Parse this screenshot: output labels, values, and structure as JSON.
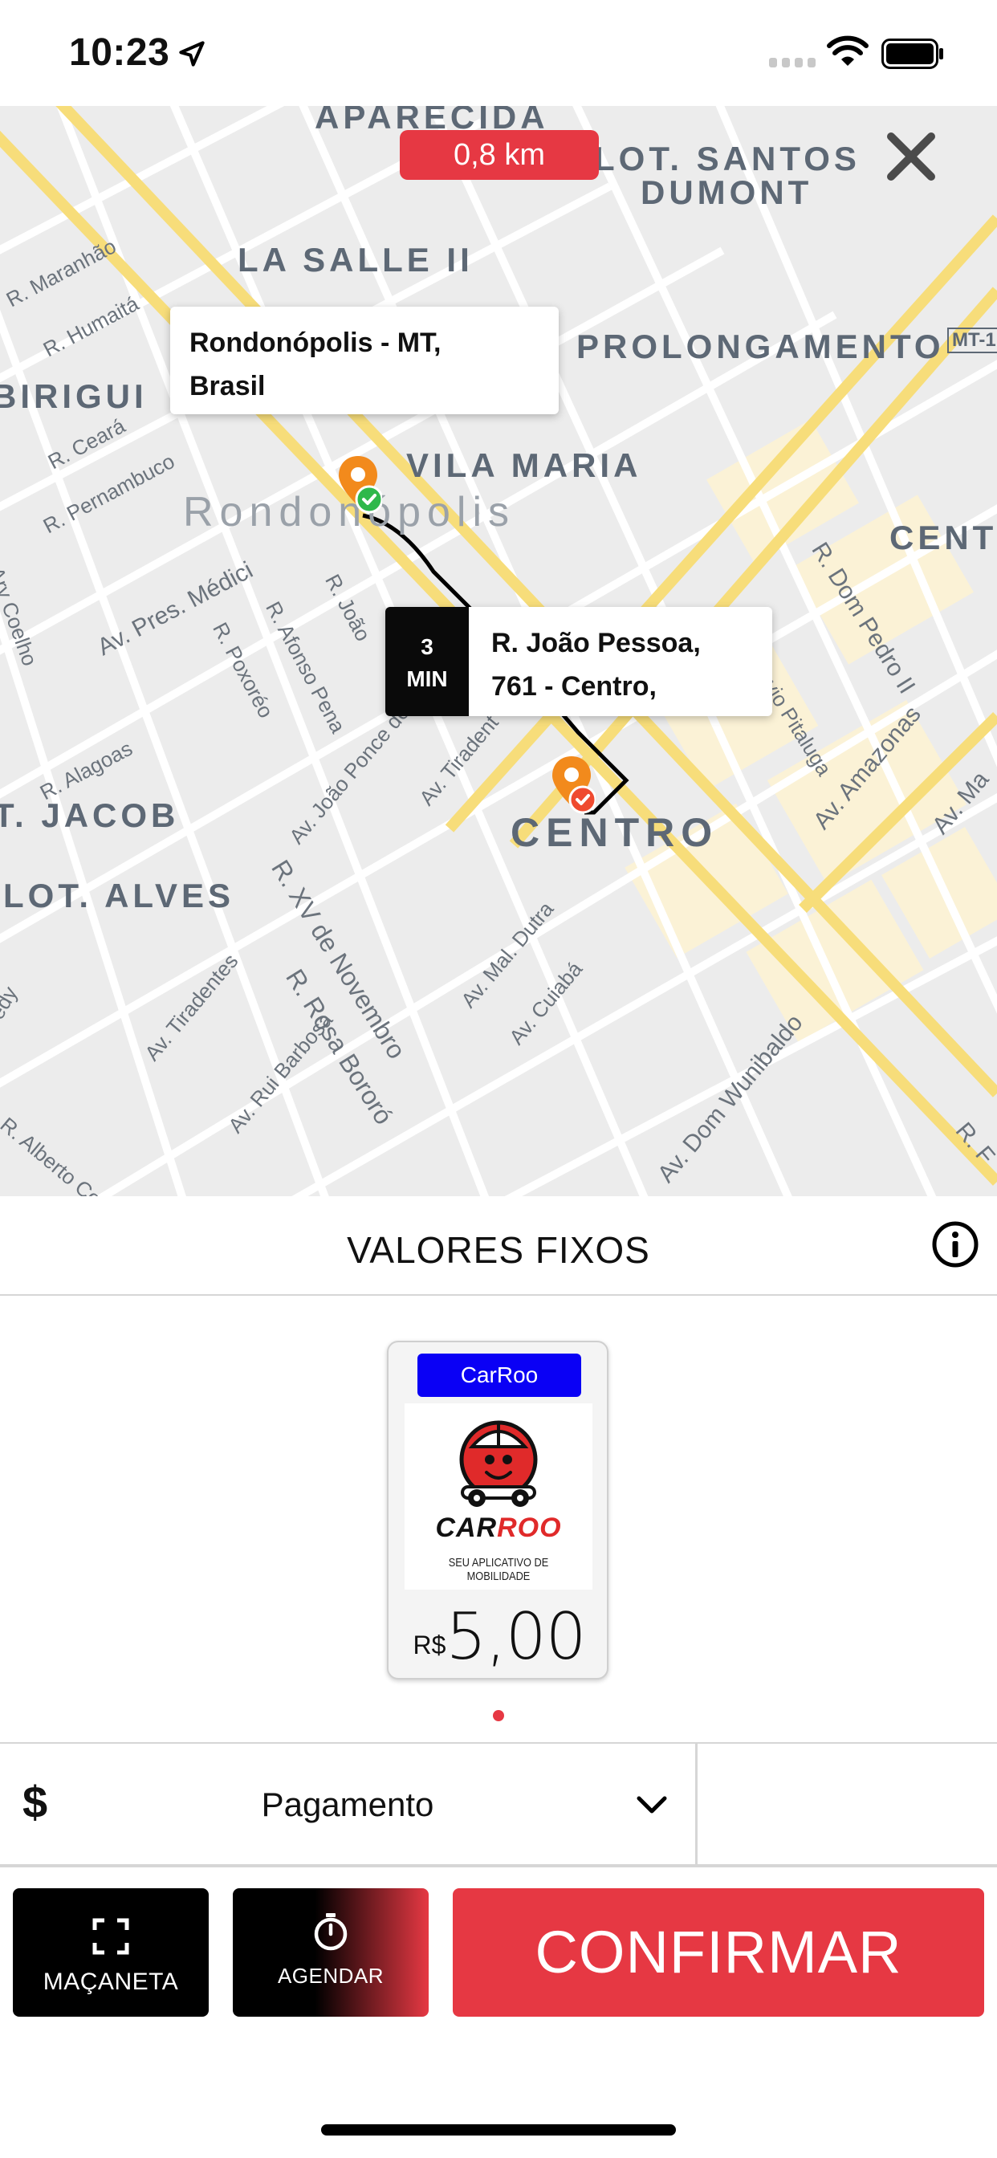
{
  "status_bar": {
    "time": "10:23"
  },
  "map": {
    "distance": "0,8 km",
    "origin_callout": "Rondonópolis - MT, Brasil",
    "origin_line1": "Rondonópolis - MT,",
    "origin_line2": "Brasil",
    "eta_value": "3",
    "eta_unit": "MIN",
    "dest_line1": "R. João Pessoa,",
    "dest_line2": "761 - Centro,",
    "labels": {
      "aparecida": "APARECIDA",
      "santos": "LOT. SANTOS",
      "dumont": "DUMONT",
      "lasalle": "LA SALLE II",
      "prolongamento": "PROLONGAMENTO",
      "mt": "MT-1",
      "birigui": "BIRIGUI",
      "vila_maria": "VILA MARIA",
      "rondonopolis": "Rondonópolis",
      "cent": "CENT",
      "centro": "CENTRO",
      "jacob": "T. JACOB",
      "alves": "LOT. ALVES",
      "maranhao": "R. Maranhão",
      "humaita": "R. Humaitá",
      "ceara": "R. Ceará",
      "pernambuco": "R. Pernambuco",
      "ary": "Ary Coelho",
      "pres_medici": "Av. Pres. Médici",
      "r_joao": "R. João",
      "afonso_pena": "R. Afonso Pena",
      "poxoreo": "R. Poxoréo",
      "dom_pedro": "R. Dom Pedro II",
      "pitaluga": "avio Pitaluga",
      "amazonas": "Av. Amazonas",
      "av_ma": "Av. Ma",
      "alagoas": "R. Alagoas",
      "joao_ponce": "Av. João Ponce de",
      "tiradentes_a": "Av. Tiradent",
      "xv": "R. XV de Novembro",
      "rosa_bororo": "R. Rosa Bororó",
      "mal_dutra": "Av. Mal. Dutra",
      "cuiaba": "Av. Cuiabá",
      "tiradentes_b": "Av. Tiradentes",
      "rui_barbosa": "Av. Rui Barbosa",
      "dom_wunibaldo": "Av. Dom Wunibaldo",
      "alberto": "R. Alberto Corrê",
      "r_f": "R. F",
      "edy": "edy"
    }
  },
  "fixed_values": {
    "title": "VALORES FIXOS",
    "card": {
      "badge": "CarRoo",
      "logo_word_black": "CAR",
      "logo_word_red": "ROO",
      "logo_tagline": "SEU APLICATIVO DE MOBILIDADE",
      "currency": "R$",
      "price": "5,00"
    }
  },
  "payment": {
    "currency_symbol": "$",
    "label": "Pagamento"
  },
  "actions": {
    "handle": "MAÇANETA",
    "schedule": "AGENDAR",
    "confirm": "CONFIRMAR"
  },
  "colors": {
    "accent": "#e63843",
    "badge": "#0a00f5",
    "route": "#000000",
    "pin": "#f28a1c"
  }
}
